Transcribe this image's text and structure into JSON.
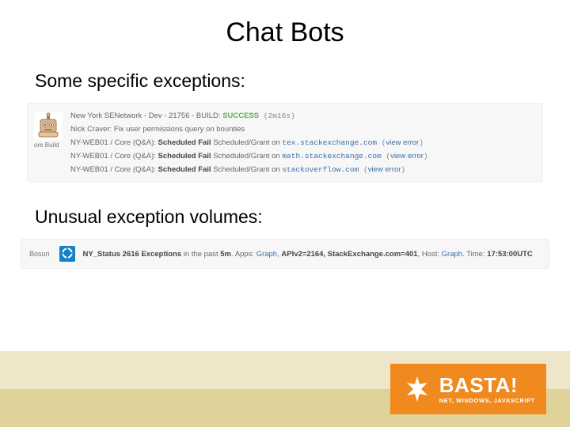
{
  "title": "Chat Bots",
  "subhead1": "Some specific exceptions:",
  "subhead2": "Unusual exception volumes:",
  "panel1": {
    "avatar_label": "ore Build",
    "rows": [
      {
        "prefix": "New York SENetwork - Dev - 21756 - BUILD: ",
        "status": "SUCCESS",
        "suffix": " (2m16s)"
      },
      {
        "text": "Nick Craver: Fix user permissions query on bounties"
      },
      {
        "prefix": "NY-WEB01 / Core (Q&A): ",
        "bold": "Scheduled Fail",
        "mid": " Scheduled/Grant on ",
        "host": "tex.stackexchange.com",
        "tail_open": " (",
        "link": "view error",
        "tail_close": ")"
      },
      {
        "prefix": "NY-WEB01 / Core (Q&A): ",
        "bold": "Scheduled Fail",
        "mid": " Scheduled/Grant on ",
        "host": "math.stackexchange.com",
        "tail_open": " (",
        "link": "view error",
        "tail_close": ")"
      },
      {
        "prefix": "NY-WEB01 / Core (Q&A): ",
        "bold": "Scheduled Fail",
        "mid": " Scheduled/Grant on ",
        "host": "stackoverflow.com",
        "tail_open": " (",
        "link": "view error",
        "tail_close": ")"
      }
    ]
  },
  "panel2": {
    "avatar_label": "Bosun",
    "bold1": "NY_Status 2616 Exceptions",
    "mid1": " in the past ",
    "bold2": "5m",
    "mid2": ". Apps: ",
    "link1": "Graph",
    "sep1": ", ",
    "bold3": "APIv2=2164, StackExchange.com=401",
    "mid3": ", Host: ",
    "link2": "Graph",
    "mid4": ". Time: ",
    "bold4": "17:53:00UTC"
  },
  "brand": {
    "name": "BASTA!",
    "tag": "NET, WINDOWS, JAVASCRIPT"
  }
}
